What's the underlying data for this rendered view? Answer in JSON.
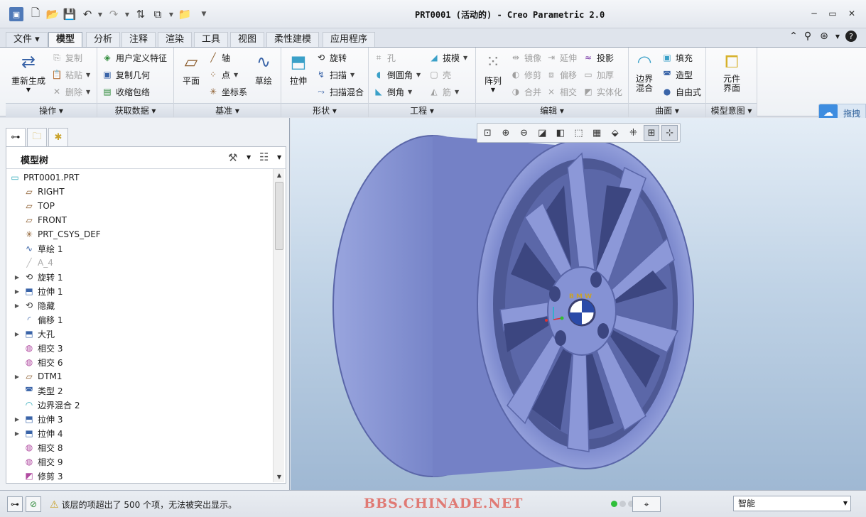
{
  "window_title": "PRT0001 (活动的) - Creo Parametric 2.0",
  "tabs": [
    "文件 ▾",
    "模型",
    "分析",
    "注释",
    "渲染",
    "工具",
    "视图",
    "柔性建模",
    "应用程序"
  ],
  "ribbon": {
    "operations": {
      "label": "操作",
      "regenerate": "重新生成",
      "copy": "复制",
      "paste": "粘贴",
      "delete": "删除"
    },
    "get_data": {
      "label": "获取数据",
      "udf": "用户定义特征",
      "copy_geom": "复制几何",
      "shrinkwrap": "收缩包络"
    },
    "datum": {
      "label": "基准",
      "plane": "平面",
      "axis": "轴",
      "point": "点",
      "csys": "坐标系",
      "sketch": "草绘"
    },
    "shapes": {
      "label": "形状",
      "extrude": "拉伸",
      "revolve": "旋转",
      "sweep": "扫描",
      "swept_blend": "扫描混合"
    },
    "engineering": {
      "label": "工程",
      "hole": "孔",
      "round": "倒圆角",
      "chamfer": "倒角",
      "draft": "拔模",
      "shell": "壳",
      "rib": "筋"
    },
    "editing": {
      "label": "编辑",
      "pattern": "阵列",
      "mirror": "镜像",
      "trim": "修剪",
      "merge": "合并",
      "extend": "延伸",
      "offset": "偏移",
      "intersect": "相交",
      "project": "投影",
      "thicken": "加厚",
      "solidify": "实体化"
    },
    "surfaces": {
      "label": "曲面",
      "boundary_blend": "边界\n混合",
      "fill": "填充",
      "style": "造型",
      "freestyle": "自由式"
    },
    "model_intent": {
      "label": "模型意图",
      "component_interface": "元件\n界面"
    }
  },
  "baidu_widget": {
    "label": "拖拽"
  },
  "tree": {
    "title": "模型树",
    "items": [
      {
        "label": "PRT0001.PRT",
        "icon": "part-icon",
        "expandable": false,
        "dim": false
      },
      {
        "label": "RIGHT",
        "icon": "datum-plane-icon",
        "expandable": false,
        "dim": false
      },
      {
        "label": "TOP",
        "icon": "datum-plane-icon",
        "expandable": false,
        "dim": false
      },
      {
        "label": "FRONT",
        "icon": "datum-plane-icon",
        "expandable": false,
        "dim": false
      },
      {
        "label": "PRT_CSYS_DEF",
        "icon": "csys-icon",
        "expandable": false,
        "dim": false
      },
      {
        "label": "草绘 1",
        "icon": "sketch-icon",
        "expandable": false,
        "dim": false
      },
      {
        "label": "A_4",
        "icon": "axis-icon",
        "expandable": false,
        "dim": true
      },
      {
        "label": "旋转 1",
        "icon": "revolve-icon",
        "expandable": true,
        "dim": false
      },
      {
        "label": "拉伸 1",
        "icon": "extrude-icon",
        "expandable": true,
        "dim": false
      },
      {
        "label": "隐藏",
        "icon": "revolve-icon",
        "expandable": true,
        "dim": false
      },
      {
        "label": "偏移 1",
        "icon": "offset-icon",
        "expandable": false,
        "dim": false
      },
      {
        "label": "大孔",
        "icon": "extrude-icon",
        "expandable": true,
        "dim": false
      },
      {
        "label": "相交 3",
        "icon": "intersect-icon",
        "expandable": false,
        "dim": false
      },
      {
        "label": "相交 6",
        "icon": "intersect-icon",
        "expandable": false,
        "dim": false
      },
      {
        "label": "DTM1",
        "icon": "datum-plane-icon",
        "expandable": true,
        "dim": false
      },
      {
        "label": "类型 2",
        "icon": "style-icon",
        "expandable": false,
        "dim": false
      },
      {
        "label": "边界混合 2",
        "icon": "boundary-blend-icon",
        "expandable": false,
        "dim": false
      },
      {
        "label": "拉伸 3",
        "icon": "extrude-icon",
        "expandable": true,
        "dim": false
      },
      {
        "label": "拉伸 4",
        "icon": "extrude-icon",
        "expandable": true,
        "dim": false
      },
      {
        "label": "相交 8",
        "icon": "intersect-icon",
        "expandable": false,
        "dim": false
      },
      {
        "label": "相交 9",
        "icon": "intersect-icon",
        "expandable": false,
        "dim": false
      },
      {
        "label": "修剪 3",
        "icon": "trim-icon",
        "expandable": false,
        "dim": false
      }
    ]
  },
  "status": {
    "message": "该层的项超出了 500 个项，无法被突出显示。",
    "watermark": "BBS.CHINADE.NET",
    "filter": "智能"
  },
  "colors": {
    "wheel": "#7e8bd0",
    "viewport_top": "#e4edf6",
    "viewport_bottom": "#9fb8d3",
    "accent": "#3e8de0"
  }
}
